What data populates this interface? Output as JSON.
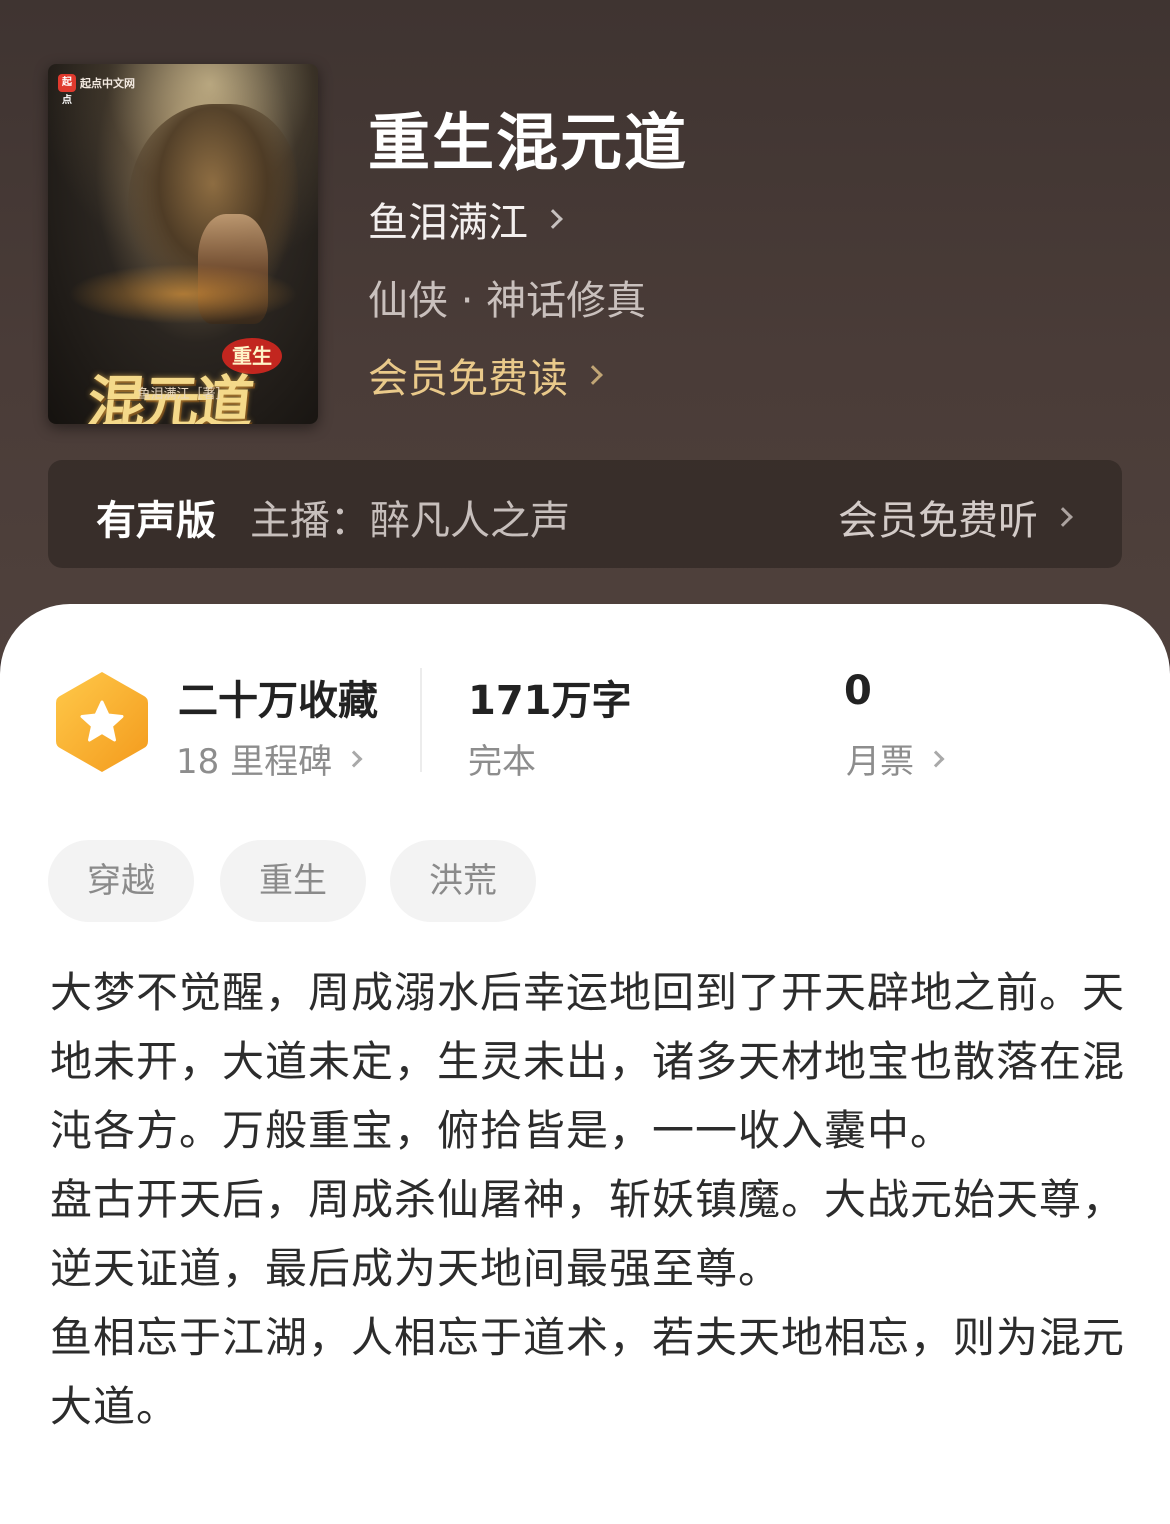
{
  "book": {
    "title": "重生混元道",
    "author": "鱼泪满江",
    "genre": "仙侠 · 神话修真",
    "vip_read": "会员免费读"
  },
  "cover": {
    "publisher_logo": "起点中文网",
    "logo_mark": "起点",
    "subtitle": "重生",
    "title": "混元道",
    "author_line": "鱼泪满江［著］"
  },
  "audio": {
    "label": "有声版",
    "host": "主播：醉凡人之声",
    "vip_listen": "会员免费听"
  },
  "stats": {
    "favorites": "二十万收藏",
    "milestones": "18 里程碑",
    "words": "171万字",
    "status": "完本",
    "monthly_votes": "0",
    "monthly_votes_label": "月票"
  },
  "tags": [
    "穿越",
    "重生",
    "洪荒"
  ],
  "description": [
    "大梦不觉醒，周成溺水后幸运地回到了开天辟地之前。天地未开，大道未定，生灵未出，诸多天材地宝也散落在混沌各方。万般重宝，俯拾皆是，一一收入囊中。",
    "盘古开天后，周成杀仙屠神，斩妖镇魔。大战元始天尊，逆天证道，最后成为天地间最强至尊。",
    "鱼相忘于江湖，人相忘于道术，若夫天地相忘，则为混元大道。"
  ],
  "colors": {
    "header_bg": "#4a3c38",
    "vip_gold": "#e9c98a",
    "badge_orange": "#f5a623"
  }
}
